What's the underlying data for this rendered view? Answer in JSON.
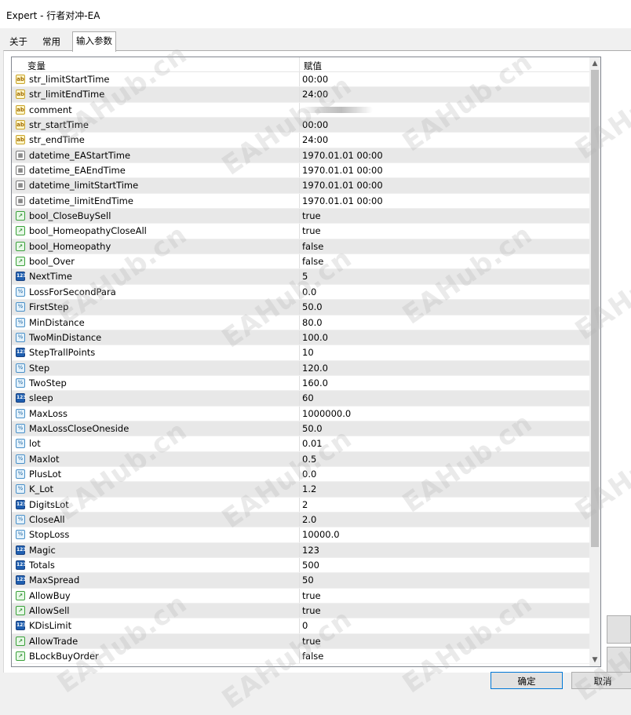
{
  "window": {
    "title": "Expert - 行者对冲-EA"
  },
  "tabs": [
    {
      "label": "关于"
    },
    {
      "label": "常用"
    },
    {
      "label": "输入参数"
    }
  ],
  "table": {
    "col_variable": "变量",
    "col_value": "赋值",
    "rows": [
      {
        "name": "str_limitStartTime",
        "value": "00:00",
        "type_icon": "ab"
      },
      {
        "name": "str_limitEndTime",
        "value": "24:00",
        "type_icon": "ab"
      },
      {
        "name": "comment",
        "value": "",
        "type_icon": "ab"
      },
      {
        "name": "str_startTime",
        "value": "00:00",
        "type_icon": "ab"
      },
      {
        "name": "str_endTime",
        "value": "24:00",
        "type_icon": "ab"
      },
      {
        "name": "datetime_EAStartTime",
        "value": "1970.01.01 00:00",
        "type_icon": "dt"
      },
      {
        "name": "datetime_EAEndTime",
        "value": "1970.01.01 00:00",
        "type_icon": "dt"
      },
      {
        "name": "datetime_limitStartTime",
        "value": "1970.01.01 00:00",
        "type_icon": "dt"
      },
      {
        "name": "datetime_limitEndTime",
        "value": "1970.01.01 00:00",
        "type_icon": "dt"
      },
      {
        "name": "bool_CloseBuySell",
        "value": "true",
        "type_icon": "bool"
      },
      {
        "name": "bool_HomeopathyCloseAll",
        "value": "true",
        "type_icon": "bool"
      },
      {
        "name": "bool_Homeopathy",
        "value": "false",
        "type_icon": "bool"
      },
      {
        "name": "bool_Over",
        "value": "false",
        "type_icon": "bool"
      },
      {
        "name": "NextTime",
        "value": "5",
        "type_icon": "int"
      },
      {
        "name": "LossForSecondPara",
        "value": "0.0",
        "type_icon": "dbl"
      },
      {
        "name": "FirstStep",
        "value": "50.0",
        "type_icon": "dbl"
      },
      {
        "name": "MinDistance",
        "value": "80.0",
        "type_icon": "dbl"
      },
      {
        "name": "TwoMinDistance",
        "value": "100.0",
        "type_icon": "dbl"
      },
      {
        "name": "StepTrallPoints",
        "value": "10",
        "type_icon": "int"
      },
      {
        "name": "Step",
        "value": "120.0",
        "type_icon": "dbl"
      },
      {
        "name": "TwoStep",
        "value": "160.0",
        "type_icon": "dbl"
      },
      {
        "name": "sleep",
        "value": "60",
        "type_icon": "int"
      },
      {
        "name": "MaxLoss",
        "value": "1000000.0",
        "type_icon": "dbl"
      },
      {
        "name": "MaxLossCloseOneside",
        "value": "50.0",
        "type_icon": "dbl"
      },
      {
        "name": "lot",
        "value": "0.01",
        "type_icon": "dbl"
      },
      {
        "name": "Maxlot",
        "value": "0.5",
        "type_icon": "dbl"
      },
      {
        "name": "PlusLot",
        "value": "0.0",
        "type_icon": "dbl"
      },
      {
        "name": "K_Lot",
        "value": "1.2",
        "type_icon": "dbl"
      },
      {
        "name": "DigitsLot",
        "value": "2",
        "type_icon": "int"
      },
      {
        "name": "CloseAll",
        "value": "2.0",
        "type_icon": "dbl"
      },
      {
        "name": "StopLoss",
        "value": "10000.0",
        "type_icon": "dbl"
      },
      {
        "name": "Magic",
        "value": "123",
        "type_icon": "int"
      },
      {
        "name": "Totals",
        "value": "500",
        "type_icon": "int"
      },
      {
        "name": "MaxSpread",
        "value": "50",
        "type_icon": "int"
      },
      {
        "name": "AllowBuy",
        "value": "true",
        "type_icon": "bool"
      },
      {
        "name": "AllowSell",
        "value": "true",
        "type_icon": "bool"
      },
      {
        "name": "KDisLimit",
        "value": "0",
        "type_icon": "int"
      },
      {
        "name": "AllowTrade",
        "value": "true",
        "type_icon": "bool"
      },
      {
        "name": "BLockBuyOrder",
        "value": "false",
        "type_icon": "bool"
      }
    ]
  },
  "buttons": {
    "ok": "确定",
    "cancel": "取消"
  },
  "watermark": {
    "text": "EAHub.cn"
  },
  "icons": {
    "str": "ab",
    "dt": "calendar-icon",
    "bool": "check-chart-icon",
    "int": "123",
    "dbl": "½"
  }
}
